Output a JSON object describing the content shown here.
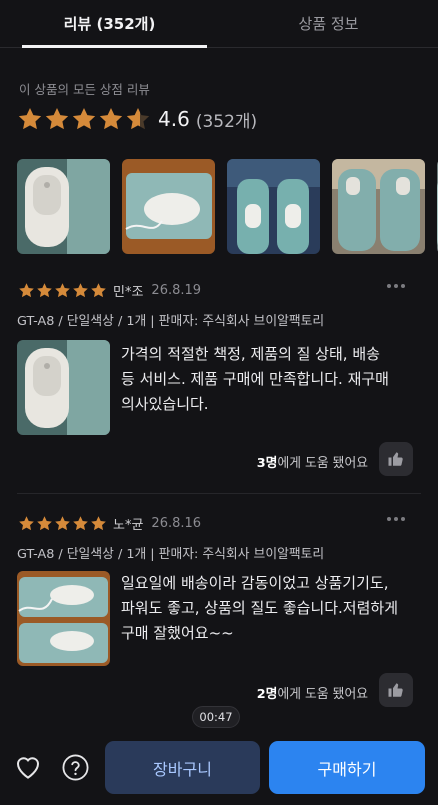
{
  "tabs": [
    {
      "label": "리뷰 (352개)",
      "active": true
    },
    {
      "label": "상품 정보",
      "active": false
    }
  ],
  "summary": {
    "caption": "이 상품의 모든 상점 리뷰",
    "rating": "4.6",
    "count": "(352개)",
    "stars_filled": 4.6,
    "star_color": "#d58a3a"
  },
  "gallery_images": [
    "review-photo-1",
    "review-photo-2",
    "review-photo-3",
    "review-photo-4",
    "review-photo-5"
  ],
  "reviews": [
    {
      "stars": 5,
      "name": "민*조",
      "date": "26.8.19",
      "meta": "GT-A8 / 단일색상 / 1개 | 판매자: 주식회사 브이알팩토리",
      "text": "가격의 적절한 책정, 제품의 질 상태, 배송\n등 서비스. 제품 구매에 만족합니다. 재구매\n의사있습니다.",
      "helpful_count": "3명",
      "helpful_suffix": "에게 도움 됐어요"
    },
    {
      "stars": 5,
      "name": "노*균",
      "date": "26.8.16",
      "meta": "GT-A8 / 단일색상 / 1개 | 판매자: 주식회사 브이알팩토리",
      "text": "일요일에 배송이라 감동이었고 상품기기도,\n파워도 좋고, 상품의 질도 좋습니다.저렴하게\n구매 잘했어요~~",
      "helpful_count": "2명",
      "helpful_suffix": "에게 도움 됐어요"
    }
  ],
  "video_timer": "00:47",
  "bottom": {
    "cart_label": "장바구니",
    "buy_label": "구매하기",
    "heart_icon": "heart-icon",
    "help_icon": "question-circle-icon",
    "buy_color": "#2c84f0"
  }
}
